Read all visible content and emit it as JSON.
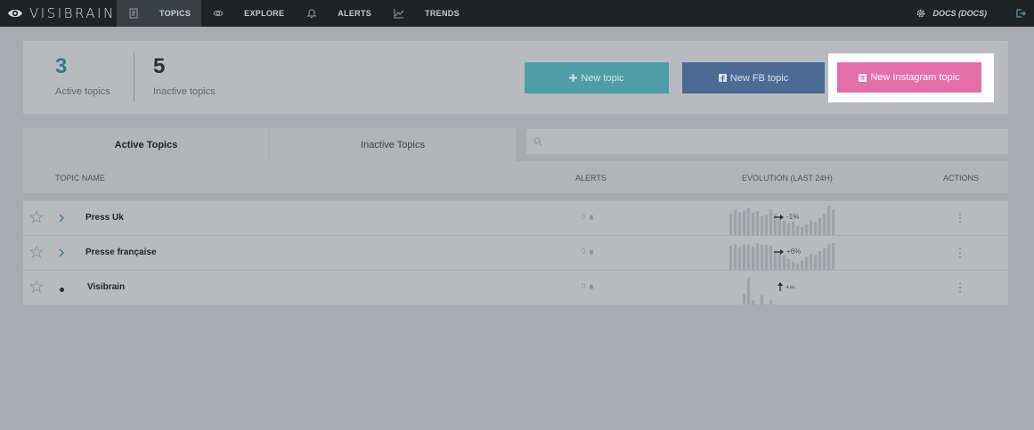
{
  "app": {
    "name": "VISIBRAIN",
    "brand_color": "#1f2326",
    "accent": "#2d7f8d"
  },
  "nav": {
    "items": [
      {
        "label": "TOPICS",
        "icon": "document-icon",
        "active": true
      },
      {
        "label": "EXPLORE",
        "icon": "eye-icon",
        "active": false
      },
      {
        "label": "ALERTS",
        "icon": "bell-icon",
        "active": false
      },
      {
        "label": "TRENDS",
        "icon": "trend-chart-icon",
        "active": false
      }
    ],
    "account_label": "DOCS (DOCS)",
    "account_icon": "gear-icon",
    "logout_icon": "logout-icon"
  },
  "stats": {
    "active": {
      "value": "3",
      "label": "Active topics"
    },
    "inactive": {
      "value": "5",
      "label": "Inactive topics"
    }
  },
  "buttons": {
    "new_topic": {
      "label": "New topic",
      "icon": "plus-icon",
      "color": "#4d9ea6"
    },
    "new_fb_topic": {
      "label": "New FB topic",
      "icon": "facebook-icon",
      "color": "#4b6a94"
    },
    "new_instagram_topic": {
      "label": "New Instagram topic",
      "icon": "instagram-icon",
      "color": "#e46eaa"
    }
  },
  "tabs": {
    "active": "Active Topics",
    "inactive": "Inactive Topics"
  },
  "search": {
    "icon": "search-icon"
  },
  "table": {
    "headers": {
      "name": "TOPIC NAME",
      "alerts": "ALERTS",
      "evolution": "EVOLUTION (LAST 24H)",
      "actions": "ACTIONS"
    },
    "rows": [
      {
        "name": "Press Uk",
        "alerts": "0",
        "trend": "flat",
        "evolution": "-1%",
        "marker": "chevron",
        "spark": [
          0.8,
          0.95,
          0.85,
          0.9,
          1.0,
          0.85,
          0.9,
          0.7,
          0.75,
          0.95,
          0.8,
          0.6,
          0.55,
          0.45,
          0.5,
          0.35,
          0.3,
          0.4,
          0.55,
          0.5,
          0.65,
          0.8,
          1.1,
          0.95
        ]
      },
      {
        "name": "Presse française",
        "alerts": "0",
        "trend": "flat",
        "evolution": "+6%",
        "marker": "chevron",
        "spark": [
          0.9,
          0.95,
          0.85,
          0.95,
          0.95,
          0.9,
          1.0,
          0.95,
          0.95,
          0.9,
          0.7,
          0.65,
          0.55,
          0.4,
          0.3,
          0.25,
          0.35,
          0.5,
          0.6,
          0.55,
          0.7,
          0.8,
          0.95,
          1.0
        ]
      },
      {
        "name": "Visibrain",
        "alerts": "0",
        "trend": "up",
        "evolution": "+∞",
        "marker": "dot",
        "spark": [
          0.0,
          0.0,
          0.0,
          0.4,
          1.0,
          0.15,
          0.0,
          0.35,
          0.0,
          0.15,
          0,
          0,
          0,
          0,
          0,
          0,
          0,
          0,
          0,
          0,
          0,
          0,
          0,
          0
        ]
      }
    ]
  }
}
